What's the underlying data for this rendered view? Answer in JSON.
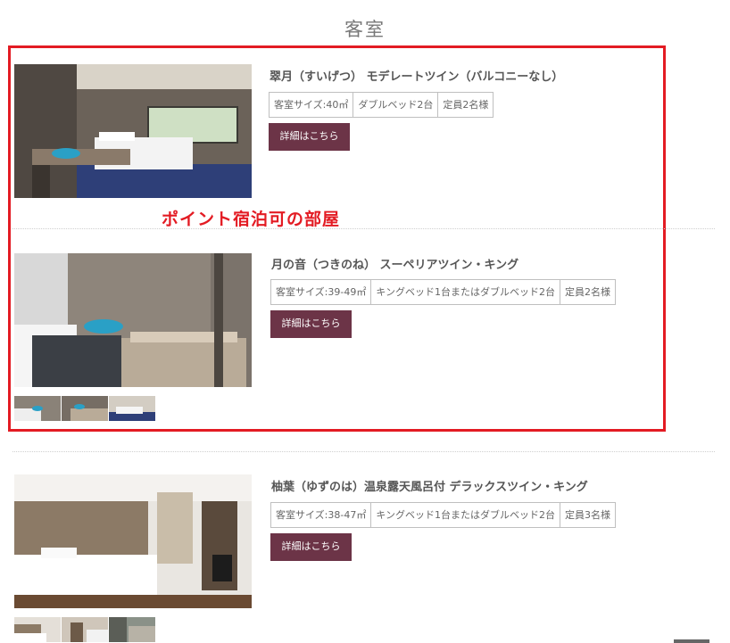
{
  "page": {
    "title": "客室"
  },
  "highlight": {
    "label": "ポイント宿泊可の部屋"
  },
  "rooms": [
    {
      "name": "翠月（すいげつ） モデレートツイン（バルコニーなし）",
      "specs": [
        "客室サイズ:40㎡",
        "ダブルベッド2台",
        "定員2名様"
      ],
      "button": "詳細はこちら"
    },
    {
      "name": "月の音（つきのね） スーペリアツイン・キング",
      "specs": [
        "客室サイズ:39-49㎡",
        "キングベッド1台またはダブルベッド2台",
        "定員2名様"
      ],
      "button": "詳細はこちら"
    },
    {
      "name": "柚葉（ゆずのは）温泉露天風呂付 デラックスツイン・キング",
      "specs": [
        "客室サイズ:38-47㎡",
        "キングベッド1台またはダブルベッド2台",
        "定員3名様"
      ],
      "button": "詳細はこちら"
    }
  ],
  "colors": {
    "accent": "#6c3447",
    "highlight": "#e31b23"
  }
}
